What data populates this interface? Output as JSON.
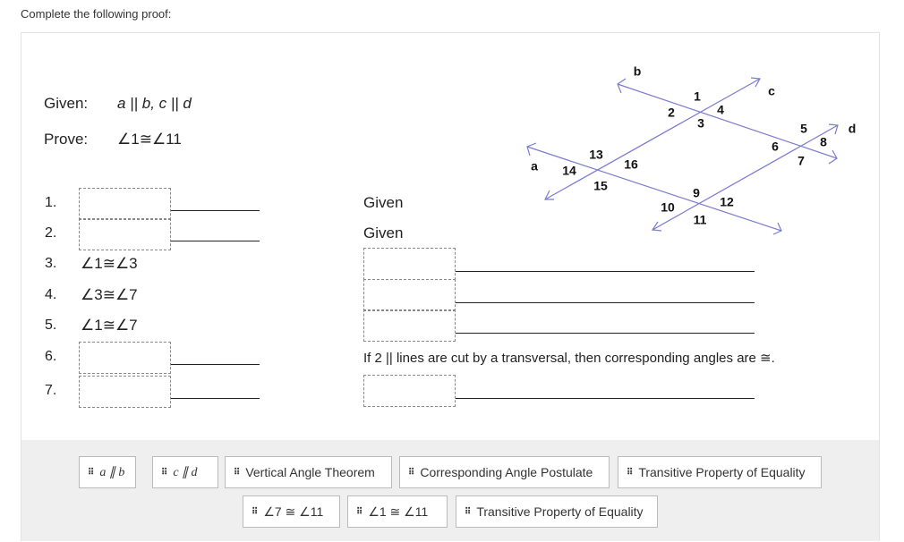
{
  "instruction": "Complete the following proof:",
  "given": {
    "label": "Given:",
    "value": "a || b, c || d"
  },
  "prove": {
    "label": "Prove:",
    "value": "∠1≅∠11"
  },
  "steps": [
    {
      "num": "1.",
      "statement": "",
      "reason": "Given"
    },
    {
      "num": "2.",
      "statement": "",
      "reason": "Given"
    },
    {
      "num": "3.",
      "statement": "∠1≅∠3",
      "reason": ""
    },
    {
      "num": "4.",
      "statement": "∠3≅∠7",
      "reason": ""
    },
    {
      "num": "5.",
      "statement": "∠1≅∠7",
      "reason": ""
    },
    {
      "num": "6.",
      "statement": "",
      "reason": "If 2 || lines are cut by a transversal, then corresponding angles are ≅."
    },
    {
      "num": "7.",
      "statement": "",
      "reason": ""
    }
  ],
  "diagram": {
    "lines": [
      "a",
      "b",
      "c",
      "d"
    ],
    "angles": [
      "1",
      "2",
      "3",
      "4",
      "5",
      "6",
      "7",
      "8",
      "9",
      "10",
      "11",
      "12",
      "13",
      "14",
      "15",
      "16"
    ],
    "color": "#7b7bd0"
  },
  "bank": [
    {
      "label": "a ∥ b",
      "math": true
    },
    {
      "label": "c ∥ d",
      "math": true
    },
    {
      "label": "Vertical Angle Theorem"
    },
    {
      "label": "Corresponding Angle Postulate"
    },
    {
      "label": "Transitive Property of Equality"
    },
    {
      "label": "∠7 ≅ ∠11"
    },
    {
      "label": "∠1 ≅ ∠11"
    },
    {
      "label": "Transitive Property of Equality"
    }
  ],
  "grip_icon": "drag-handle-icon"
}
